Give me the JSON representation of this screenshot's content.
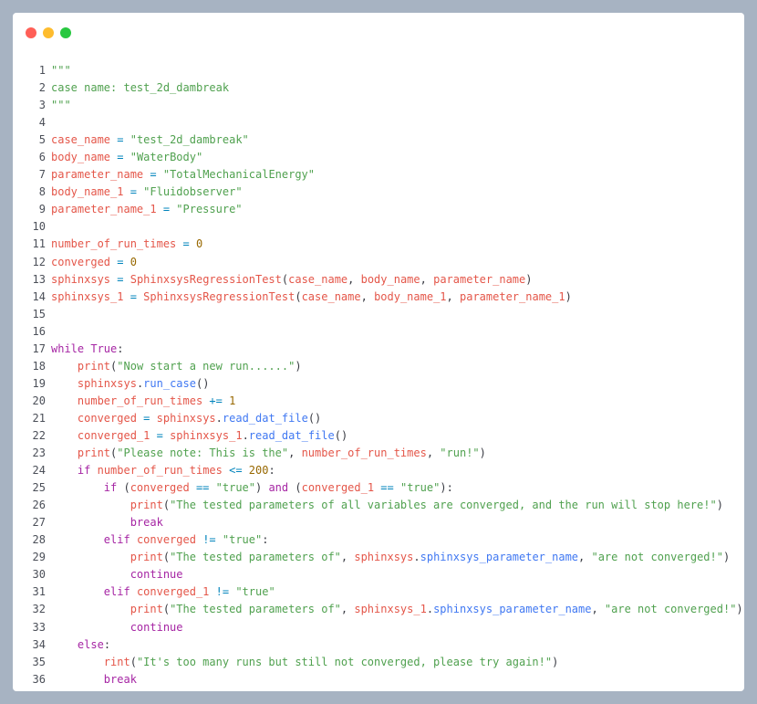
{
  "window": {
    "controls": {
      "close_color": "#ff5f57",
      "minimize_color": "#febc2e",
      "maximize_color": "#28c840"
    }
  },
  "code": {
    "language": "python",
    "lines": [
      {
        "n": "1",
        "t": [
          [
            "s",
            "\"\"\""
          ]
        ]
      },
      {
        "n": "2",
        "t": [
          [
            "s",
            "case name: test_2d_dambreak"
          ]
        ]
      },
      {
        "n": "3",
        "t": [
          [
            "s",
            "\"\"\""
          ]
        ]
      },
      {
        "n": "4",
        "t": []
      },
      {
        "n": "5",
        "t": [
          [
            "v",
            "case_name"
          ],
          [
            "o",
            " = "
          ],
          [
            "s",
            "\"test_2d_dambreak\""
          ]
        ]
      },
      {
        "n": "6",
        "t": [
          [
            "v",
            "body_name"
          ],
          [
            "o",
            " = "
          ],
          [
            "s",
            "\"WaterBody\""
          ]
        ]
      },
      {
        "n": "7",
        "t": [
          [
            "v",
            "parameter_name"
          ],
          [
            "o",
            " = "
          ],
          [
            "s",
            "\"TotalMechanicalEnergy\""
          ]
        ]
      },
      {
        "n": "8",
        "t": [
          [
            "v",
            "body_name_1"
          ],
          [
            "o",
            " = "
          ],
          [
            "s",
            "\"Fluidobserver\""
          ]
        ]
      },
      {
        "n": "9",
        "t": [
          [
            "v",
            "parameter_name_1"
          ],
          [
            "o",
            " = "
          ],
          [
            "s",
            "\"Pressure\""
          ]
        ]
      },
      {
        "n": "10",
        "t": []
      },
      {
        "n": "11",
        "t": [
          [
            "v",
            "number_of_run_times"
          ],
          [
            "o",
            " = "
          ],
          [
            "n",
            "0"
          ]
        ]
      },
      {
        "n": "12",
        "t": [
          [
            "v",
            "converged"
          ],
          [
            "o",
            " = "
          ],
          [
            "n",
            "0"
          ]
        ]
      },
      {
        "n": "13",
        "t": [
          [
            "v",
            "sphinxsys"
          ],
          [
            "o",
            " = "
          ],
          [
            "v",
            "SphinxsysRegressionTest"
          ],
          [
            "p",
            "("
          ],
          [
            "v",
            "case_name"
          ],
          [
            "p",
            ", "
          ],
          [
            "v",
            "body_name"
          ],
          [
            "p",
            ", "
          ],
          [
            "v",
            "parameter_name"
          ],
          [
            "p",
            ")"
          ]
        ]
      },
      {
        "n": "14",
        "t": [
          [
            "v",
            "sphinxsys_1"
          ],
          [
            "o",
            " = "
          ],
          [
            "v",
            "SphinxsysRegressionTest"
          ],
          [
            "p",
            "("
          ],
          [
            "v",
            "case_name"
          ],
          [
            "p",
            ", "
          ],
          [
            "v",
            "body_name_1"
          ],
          [
            "p",
            ", "
          ],
          [
            "v",
            "parameter_name_1"
          ],
          [
            "p",
            ")"
          ]
        ]
      },
      {
        "n": "15",
        "t": []
      },
      {
        "n": "16",
        "t": []
      },
      {
        "n": "17",
        "t": [
          [
            "k",
            "while"
          ],
          [
            "p",
            " "
          ],
          [
            "k",
            "True"
          ],
          [
            "p",
            ":"
          ]
        ]
      },
      {
        "n": "18",
        "t": [
          [
            "p",
            "    "
          ],
          [
            "v",
            "print"
          ],
          [
            "p",
            "("
          ],
          [
            "s",
            "\"Now start a new run......\""
          ],
          [
            "p",
            ")"
          ]
        ]
      },
      {
        "n": "19",
        "t": [
          [
            "p",
            "    "
          ],
          [
            "v",
            "sphinxsys"
          ],
          [
            "p",
            "."
          ],
          [
            "f",
            "run_case"
          ],
          [
            "p",
            "()"
          ]
        ]
      },
      {
        "n": "20",
        "t": [
          [
            "p",
            "    "
          ],
          [
            "v",
            "number_of_run_times"
          ],
          [
            "o",
            " += "
          ],
          [
            "n",
            "1"
          ]
        ]
      },
      {
        "n": "21",
        "t": [
          [
            "p",
            "    "
          ],
          [
            "v",
            "converged"
          ],
          [
            "o",
            " = "
          ],
          [
            "v",
            "sphinxsys"
          ],
          [
            "p",
            "."
          ],
          [
            "f",
            "read_dat_file"
          ],
          [
            "p",
            "()"
          ]
        ]
      },
      {
        "n": "22",
        "t": [
          [
            "p",
            "    "
          ],
          [
            "v",
            "converged_1"
          ],
          [
            "o",
            " = "
          ],
          [
            "v",
            "sphinxsys_1"
          ],
          [
            "p",
            "."
          ],
          [
            "f",
            "read_dat_file"
          ],
          [
            "p",
            "()"
          ]
        ]
      },
      {
        "n": "23",
        "t": [
          [
            "p",
            "    "
          ],
          [
            "v",
            "print"
          ],
          [
            "p",
            "("
          ],
          [
            "s",
            "\"Please note: This is the\""
          ],
          [
            "p",
            ", "
          ],
          [
            "v",
            "number_of_run_times"
          ],
          [
            "p",
            ", "
          ],
          [
            "s",
            "\"run!\""
          ],
          [
            "p",
            ")"
          ]
        ]
      },
      {
        "n": "24",
        "t": [
          [
            "p",
            "    "
          ],
          [
            "k",
            "if"
          ],
          [
            "p",
            " "
          ],
          [
            "v",
            "number_of_run_times"
          ],
          [
            "o",
            " <= "
          ],
          [
            "n",
            "200"
          ],
          [
            "p",
            ":"
          ]
        ]
      },
      {
        "n": "25",
        "t": [
          [
            "p",
            "        "
          ],
          [
            "k",
            "if"
          ],
          [
            "p",
            " ("
          ],
          [
            "v",
            "converged"
          ],
          [
            "o",
            " == "
          ],
          [
            "s",
            "\"true\""
          ],
          [
            "p",
            ") "
          ],
          [
            "k",
            "and"
          ],
          [
            "p",
            " ("
          ],
          [
            "v",
            "converged_1"
          ],
          [
            "o",
            " == "
          ],
          [
            "s",
            "\"true\""
          ],
          [
            "p",
            "):"
          ]
        ]
      },
      {
        "n": "26",
        "t": [
          [
            "p",
            "            "
          ],
          [
            "v",
            "print"
          ],
          [
            "p",
            "("
          ],
          [
            "s",
            "\"The tested parameters of all variables are converged, and the run will stop here!\""
          ],
          [
            "p",
            ")"
          ]
        ]
      },
      {
        "n": "27",
        "t": [
          [
            "p",
            "            "
          ],
          [
            "k",
            "break"
          ]
        ]
      },
      {
        "n": "28",
        "t": [
          [
            "p",
            "        "
          ],
          [
            "k",
            "elif"
          ],
          [
            "p",
            " "
          ],
          [
            "v",
            "converged"
          ],
          [
            "o",
            " != "
          ],
          [
            "s",
            "\"true\""
          ],
          [
            "p",
            ":"
          ]
        ]
      },
      {
        "n": "29",
        "t": [
          [
            "p",
            "            "
          ],
          [
            "v",
            "print"
          ],
          [
            "p",
            "("
          ],
          [
            "s",
            "\"The tested parameters of\""
          ],
          [
            "p",
            ", "
          ],
          [
            "v",
            "sphinxsys"
          ],
          [
            "p",
            "."
          ],
          [
            "f",
            "sphinxsys_parameter_name"
          ],
          [
            "p",
            ", "
          ],
          [
            "s",
            "\"are not converged!\""
          ],
          [
            "p",
            ")"
          ]
        ]
      },
      {
        "n": "30",
        "t": [
          [
            "p",
            "            "
          ],
          [
            "k",
            "continue"
          ]
        ]
      },
      {
        "n": "31",
        "t": [
          [
            "p",
            "        "
          ],
          [
            "k",
            "elif"
          ],
          [
            "p",
            " "
          ],
          [
            "v",
            "converged_1"
          ],
          [
            "o",
            " != "
          ],
          [
            "s",
            "\"true\""
          ]
        ]
      },
      {
        "n": "32",
        "t": [
          [
            "p",
            "            "
          ],
          [
            "v",
            "print"
          ],
          [
            "p",
            "("
          ],
          [
            "s",
            "\"The tested parameters of\""
          ],
          [
            "p",
            ", "
          ],
          [
            "v",
            "sphinxsys_1"
          ],
          [
            "p",
            "."
          ],
          [
            "f",
            "sphinxsys_parameter_name"
          ],
          [
            "p",
            ", "
          ],
          [
            "s",
            "\"are not converged!\""
          ],
          [
            "p",
            ")"
          ]
        ]
      },
      {
        "n": "33",
        "t": [
          [
            "p",
            "            "
          ],
          [
            "k",
            "continue"
          ]
        ]
      },
      {
        "n": "34",
        "t": [
          [
            "p",
            "    "
          ],
          [
            "k",
            "else"
          ],
          [
            "p",
            ":"
          ]
        ]
      },
      {
        "n": "35",
        "t": [
          [
            "p",
            "        "
          ],
          [
            "v",
            "rint"
          ],
          [
            "p",
            "("
          ],
          [
            "s",
            "\"It's too many runs but still not converged, please try again!\""
          ],
          [
            "p",
            ")"
          ]
        ]
      },
      {
        "n": "36",
        "t": [
          [
            "p",
            "        "
          ],
          [
            "k",
            "break"
          ]
        ]
      }
    ]
  }
}
